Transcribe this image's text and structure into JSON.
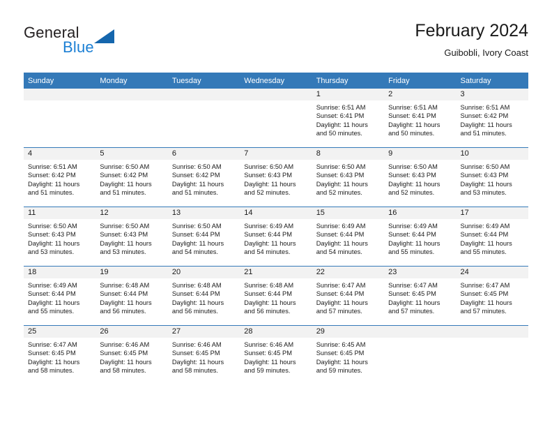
{
  "brand": {
    "name_part1": "General",
    "name_part2": "Blue",
    "triangle_color": "#1566ad",
    "blue_color": "#1b7fd4"
  },
  "header": {
    "title": "February 2024",
    "subtitle": "Guibobli, Ivory Coast",
    "header_bg_color": "#3479b8"
  },
  "weekday_headers": [
    "Sunday",
    "Monday",
    "Tuesday",
    "Wednesday",
    "Thursday",
    "Friday",
    "Saturday"
  ],
  "weeks": [
    [
      {
        "day": "",
        "sunrise": "",
        "sunset": "",
        "daylight_line1": "",
        "daylight_line2": ""
      },
      {
        "day": "",
        "sunrise": "",
        "sunset": "",
        "daylight_line1": "",
        "daylight_line2": ""
      },
      {
        "day": "",
        "sunrise": "",
        "sunset": "",
        "daylight_line1": "",
        "daylight_line2": ""
      },
      {
        "day": "",
        "sunrise": "",
        "sunset": "",
        "daylight_line1": "",
        "daylight_line2": ""
      },
      {
        "day": "1",
        "sunrise": "Sunrise: 6:51 AM",
        "sunset": "Sunset: 6:41 PM",
        "daylight_line1": "Daylight: 11 hours",
        "daylight_line2": "and 50 minutes."
      },
      {
        "day": "2",
        "sunrise": "Sunrise: 6:51 AM",
        "sunset": "Sunset: 6:41 PM",
        "daylight_line1": "Daylight: 11 hours",
        "daylight_line2": "and 50 minutes."
      },
      {
        "day": "3",
        "sunrise": "Sunrise: 6:51 AM",
        "sunset": "Sunset: 6:42 PM",
        "daylight_line1": "Daylight: 11 hours",
        "daylight_line2": "and 51 minutes."
      }
    ],
    [
      {
        "day": "4",
        "sunrise": "Sunrise: 6:51 AM",
        "sunset": "Sunset: 6:42 PM",
        "daylight_line1": "Daylight: 11 hours",
        "daylight_line2": "and 51 minutes."
      },
      {
        "day": "5",
        "sunrise": "Sunrise: 6:50 AM",
        "sunset": "Sunset: 6:42 PM",
        "daylight_line1": "Daylight: 11 hours",
        "daylight_line2": "and 51 minutes."
      },
      {
        "day": "6",
        "sunrise": "Sunrise: 6:50 AM",
        "sunset": "Sunset: 6:42 PM",
        "daylight_line1": "Daylight: 11 hours",
        "daylight_line2": "and 51 minutes."
      },
      {
        "day": "7",
        "sunrise": "Sunrise: 6:50 AM",
        "sunset": "Sunset: 6:43 PM",
        "daylight_line1": "Daylight: 11 hours",
        "daylight_line2": "and 52 minutes."
      },
      {
        "day": "8",
        "sunrise": "Sunrise: 6:50 AM",
        "sunset": "Sunset: 6:43 PM",
        "daylight_line1": "Daylight: 11 hours",
        "daylight_line2": "and 52 minutes."
      },
      {
        "day": "9",
        "sunrise": "Sunrise: 6:50 AM",
        "sunset": "Sunset: 6:43 PM",
        "daylight_line1": "Daylight: 11 hours",
        "daylight_line2": "and 52 minutes."
      },
      {
        "day": "10",
        "sunrise": "Sunrise: 6:50 AM",
        "sunset": "Sunset: 6:43 PM",
        "daylight_line1": "Daylight: 11 hours",
        "daylight_line2": "and 53 minutes."
      }
    ],
    [
      {
        "day": "11",
        "sunrise": "Sunrise: 6:50 AM",
        "sunset": "Sunset: 6:43 PM",
        "daylight_line1": "Daylight: 11 hours",
        "daylight_line2": "and 53 minutes."
      },
      {
        "day": "12",
        "sunrise": "Sunrise: 6:50 AM",
        "sunset": "Sunset: 6:43 PM",
        "daylight_line1": "Daylight: 11 hours",
        "daylight_line2": "and 53 minutes."
      },
      {
        "day": "13",
        "sunrise": "Sunrise: 6:50 AM",
        "sunset": "Sunset: 6:44 PM",
        "daylight_line1": "Daylight: 11 hours",
        "daylight_line2": "and 54 minutes."
      },
      {
        "day": "14",
        "sunrise": "Sunrise: 6:49 AM",
        "sunset": "Sunset: 6:44 PM",
        "daylight_line1": "Daylight: 11 hours",
        "daylight_line2": "and 54 minutes."
      },
      {
        "day": "15",
        "sunrise": "Sunrise: 6:49 AM",
        "sunset": "Sunset: 6:44 PM",
        "daylight_line1": "Daylight: 11 hours",
        "daylight_line2": "and 54 minutes."
      },
      {
        "day": "16",
        "sunrise": "Sunrise: 6:49 AM",
        "sunset": "Sunset: 6:44 PM",
        "daylight_line1": "Daylight: 11 hours",
        "daylight_line2": "and 55 minutes."
      },
      {
        "day": "17",
        "sunrise": "Sunrise: 6:49 AM",
        "sunset": "Sunset: 6:44 PM",
        "daylight_line1": "Daylight: 11 hours",
        "daylight_line2": "and 55 minutes."
      }
    ],
    [
      {
        "day": "18",
        "sunrise": "Sunrise: 6:49 AM",
        "sunset": "Sunset: 6:44 PM",
        "daylight_line1": "Daylight: 11 hours",
        "daylight_line2": "and 55 minutes."
      },
      {
        "day": "19",
        "sunrise": "Sunrise: 6:48 AM",
        "sunset": "Sunset: 6:44 PM",
        "daylight_line1": "Daylight: 11 hours",
        "daylight_line2": "and 56 minutes."
      },
      {
        "day": "20",
        "sunrise": "Sunrise: 6:48 AM",
        "sunset": "Sunset: 6:44 PM",
        "daylight_line1": "Daylight: 11 hours",
        "daylight_line2": "and 56 minutes."
      },
      {
        "day": "21",
        "sunrise": "Sunrise: 6:48 AM",
        "sunset": "Sunset: 6:44 PM",
        "daylight_line1": "Daylight: 11 hours",
        "daylight_line2": "and 56 minutes."
      },
      {
        "day": "22",
        "sunrise": "Sunrise: 6:47 AM",
        "sunset": "Sunset: 6:44 PM",
        "daylight_line1": "Daylight: 11 hours",
        "daylight_line2": "and 57 minutes."
      },
      {
        "day": "23",
        "sunrise": "Sunrise: 6:47 AM",
        "sunset": "Sunset: 6:45 PM",
        "daylight_line1": "Daylight: 11 hours",
        "daylight_line2": "and 57 minutes."
      },
      {
        "day": "24",
        "sunrise": "Sunrise: 6:47 AM",
        "sunset": "Sunset: 6:45 PM",
        "daylight_line1": "Daylight: 11 hours",
        "daylight_line2": "and 57 minutes."
      }
    ],
    [
      {
        "day": "25",
        "sunrise": "Sunrise: 6:47 AM",
        "sunset": "Sunset: 6:45 PM",
        "daylight_line1": "Daylight: 11 hours",
        "daylight_line2": "and 58 minutes."
      },
      {
        "day": "26",
        "sunrise": "Sunrise: 6:46 AM",
        "sunset": "Sunset: 6:45 PM",
        "daylight_line1": "Daylight: 11 hours",
        "daylight_line2": "and 58 minutes."
      },
      {
        "day": "27",
        "sunrise": "Sunrise: 6:46 AM",
        "sunset": "Sunset: 6:45 PM",
        "daylight_line1": "Daylight: 11 hours",
        "daylight_line2": "and 58 minutes."
      },
      {
        "day": "28",
        "sunrise": "Sunrise: 6:46 AM",
        "sunset": "Sunset: 6:45 PM",
        "daylight_line1": "Daylight: 11 hours",
        "daylight_line2": "and 59 minutes."
      },
      {
        "day": "29",
        "sunrise": "Sunrise: 6:45 AM",
        "sunset": "Sunset: 6:45 PM",
        "daylight_line1": "Daylight: 11 hours",
        "daylight_line2": "and 59 minutes."
      },
      {
        "day": "",
        "sunrise": "",
        "sunset": "",
        "daylight_line1": "",
        "daylight_line2": ""
      },
      {
        "day": "",
        "sunrise": "",
        "sunset": "",
        "daylight_line1": "",
        "daylight_line2": ""
      }
    ]
  ]
}
